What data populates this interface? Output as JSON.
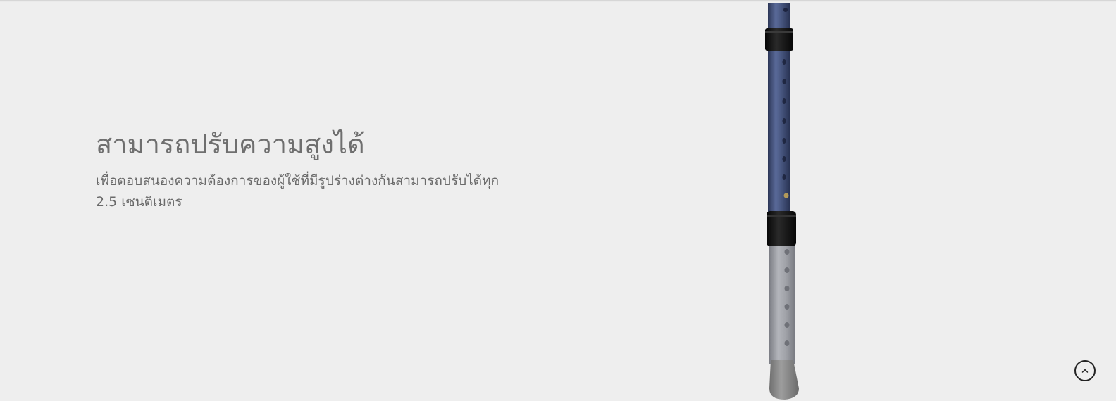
{
  "feature": {
    "title": "สามารถปรับความสูงได้",
    "description": "เพื่อตอบสนองความต้องการของผู้ใช้ที่มีรูปร่างต่างกันสามารถปรับได้ทุก 2.5 เซนติเมตร"
  },
  "product_image": {
    "subject": "adjustable-crutch-leg-icon",
    "colors": {
      "upper_tube": "#3f4d78",
      "lower_tube": "#9a9ca3",
      "collar": "#141414",
      "foot": "#8e8e8e"
    }
  },
  "scroll_to_top": {
    "icon": "chevron-up-icon"
  },
  "colors": {
    "background": "#eeeeee",
    "heading_text": "#6f6f6f",
    "body_text": "#6a6a6a"
  }
}
